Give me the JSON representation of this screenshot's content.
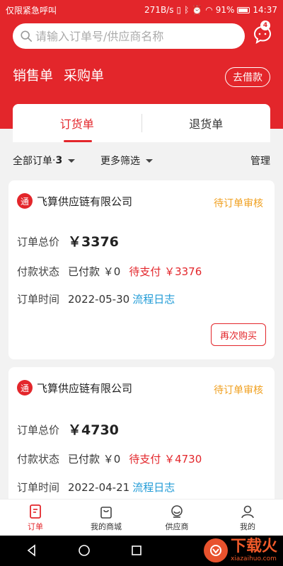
{
  "status_bar": {
    "left_text": "仅限紧急呼叫",
    "speed": "271B/s",
    "battery": "91%",
    "time": "14:37"
  },
  "search": {
    "placeholder": "请输入订单号/供应商名称"
  },
  "messages": {
    "badge": "4"
  },
  "top_tabs": {
    "sale": "销售单",
    "purchase": "采购单",
    "borrow": "去借款"
  },
  "sub_tabs": {
    "order": "订货单",
    "return": "退货单"
  },
  "filter": {
    "all_label": "全部订单",
    "all_sep": "·",
    "all_count": "3",
    "more": "更多筛选",
    "manage": "管理"
  },
  "labels": {
    "total": "订单总价",
    "payment_status": "付款状态",
    "order_time": "订单时间",
    "rebuy": "再次购买"
  },
  "orders": [
    {
      "supplier": "飞算供应链有限公司",
      "logo_char": "通",
      "status": "待订单审核",
      "total": "￥3376",
      "paid": "已付款 ￥0",
      "unpaid": "待支付 ￥3376",
      "date": "2022-05-30",
      "log_link": "流程日志"
    },
    {
      "supplier": "飞算供应链有限公司",
      "logo_char": "通",
      "status": "待订单审核",
      "total": "￥4730",
      "paid": "已付款 ￥0",
      "unpaid": "待支付 ￥4730",
      "date": "2022-04-21",
      "log_link": "流程日志"
    }
  ],
  "bottom_nav": [
    {
      "label": "订单",
      "icon": "order-icon"
    },
    {
      "label": "我的商城",
      "icon": "shop-bag-icon"
    },
    {
      "label": "供应商",
      "icon": "supplier-icon"
    },
    {
      "label": "我的",
      "icon": "profile-icon"
    }
  ],
  "watermark": {
    "title": "下载火",
    "subtitle": "xiazaihuo.com"
  },
  "colors": {
    "brand_red": "#e3262b",
    "status_orange": "#f0a020",
    "link_blue": "#1e9ad6"
  }
}
